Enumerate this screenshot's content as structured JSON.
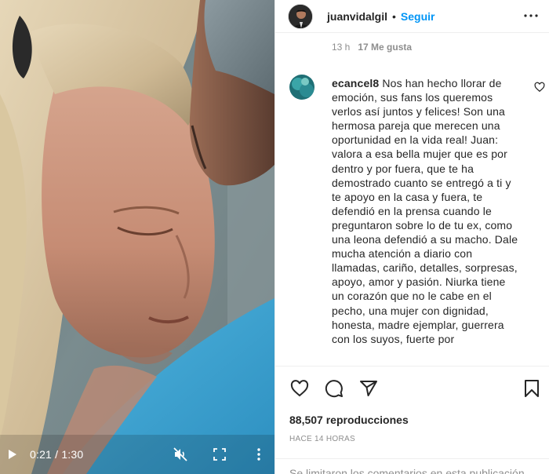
{
  "video": {
    "time_current": "0:21",
    "time_total": "1:30",
    "time_display": "0:21 / 1:30",
    "progress_fraction": 0.233,
    "icons": [
      "play-icon",
      "muted-speaker-icon",
      "fullscreen-icon",
      "more-vertical-icon"
    ]
  },
  "post": {
    "username": "juanvidalgil",
    "separator": "•",
    "follow_label": "Seguir",
    "time_ago_short": "13 h",
    "likes": "17 Me gusta"
  },
  "comment": {
    "username": "ecancel8",
    "text": "Nos han hecho llorar de emoción, sus fans los queremos verlos así juntos y felices! Son una hermosa pareja que merecen una oportunidad en la vida real! Juan: valora a esa bella mujer que es por dentro y por fuera, que te ha demostrado cuanto se entregó a ti y te apoyo en la casa y fuera, te defendió en la prensa cuando le preguntaron sobre lo de tu ex, como una leona defendió a su macho. Dale mucha atención a diario con llamadas, cariño, detalles, sorpresas, apoyo, amor y pasión. Niurka tiene un corazón que no le cabe en el pecho, una mujer con dignidad, honesta, madre ejemplar, guerrera con los suyos, fuerte por"
  },
  "stats": {
    "views": "88,507 reproducciones",
    "posted": "HACE 14 HORAS"
  },
  "footer": {
    "text": "Se limitaron los comentarios en esta publicación"
  },
  "colors": {
    "accent": "#0095f6",
    "text": "#262626",
    "muted": "#8e8e8e",
    "divider": "#efefef"
  }
}
